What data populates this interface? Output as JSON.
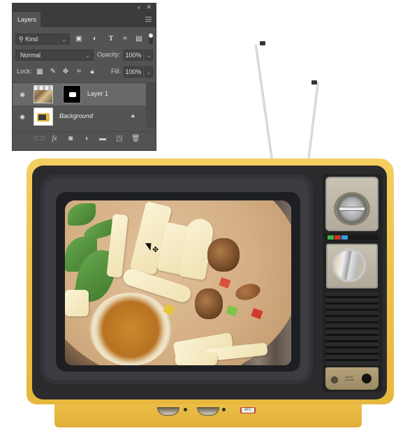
{
  "layers_panel": {
    "tab_label": "Layers",
    "collapse_glyph": "«",
    "close_glyph": "✕",
    "filter": {
      "kind_label": "Kind",
      "icons": [
        "pixel-layer-filter",
        "adjustment-layer-filter",
        "type-layer-filter",
        "shape-layer-filter",
        "smart-object-filter"
      ]
    },
    "blend_mode": "Normal",
    "opacity_label": "Opacity:",
    "opacity_value": "100%",
    "lock_label": "Lock:",
    "fill_label": "Fill:",
    "fill_value": "100%",
    "layers": [
      {
        "name": "Layer 1",
        "selected": true,
        "visible": true,
        "has_mask": true
      },
      {
        "name": "Background",
        "selected": false,
        "visible": true,
        "locked": true
      }
    ],
    "bottom_icons": [
      "link-layers",
      "fx",
      "add-mask",
      "new-adjustment",
      "new-group",
      "new-layer",
      "delete-layer"
    ],
    "fx_label": "fx"
  },
  "canvas": {
    "tv": {
      "afc_label": "AFC",
      "earphone_label": "EAR-PH VOLUME",
      "color_bars": [
        "#3fb34a",
        "#d7332a",
        "#2f9fdc"
      ],
      "body_color": "#efc24a"
    }
  }
}
